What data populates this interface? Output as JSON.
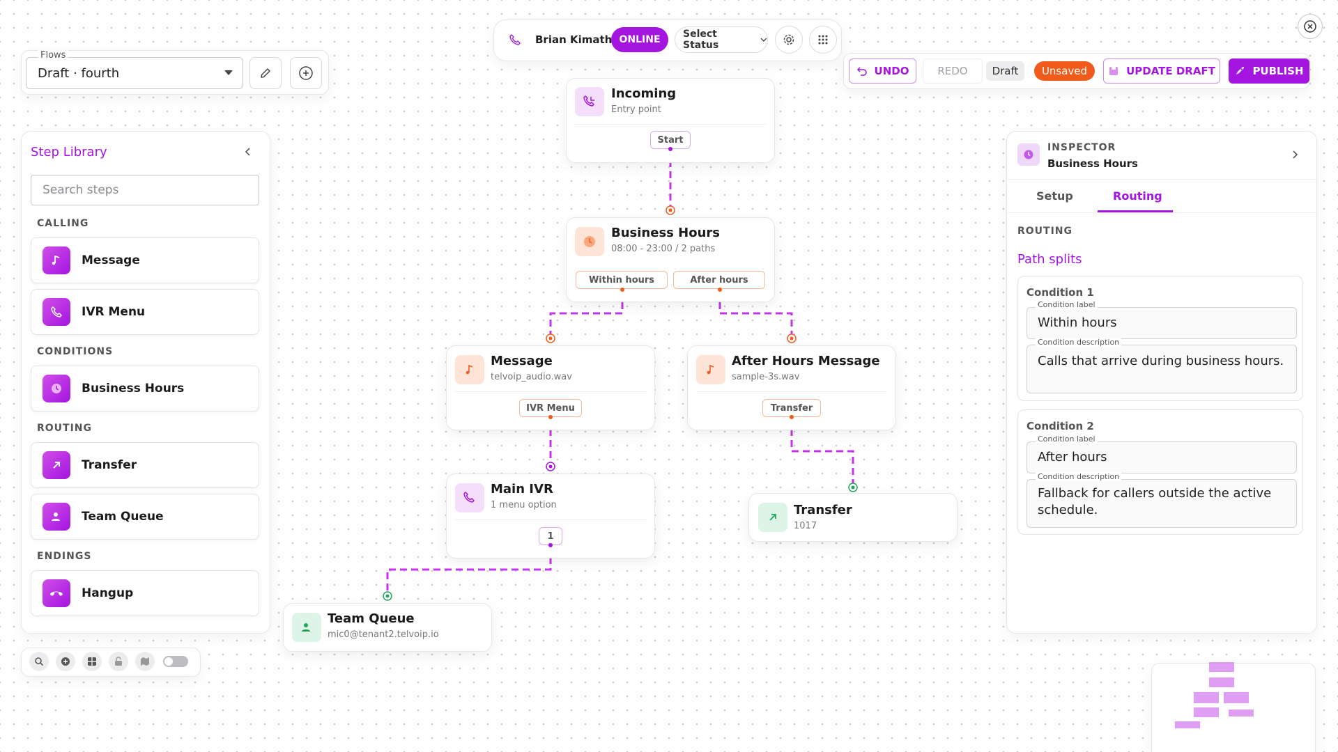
{
  "flows": {
    "label": "Flows",
    "selected": "Draft · fourth"
  },
  "agent": {
    "name": "Brian Kimathi",
    "presence": "ONLINE",
    "status_select": "Select Status"
  },
  "toolbar": {
    "undo": "UNDO",
    "redo": "REDO",
    "draft_badge": "Draft",
    "unsaved_badge": "Unsaved",
    "update_draft": "UPDATE DRAFT",
    "publish": "PUBLISH"
  },
  "library": {
    "title": "Step Library",
    "search_placeholder": "Search steps",
    "sections": [
      {
        "label": "CALLING",
        "items": [
          {
            "label": "Message",
            "icon": "music-note-icon"
          },
          {
            "label": "IVR Menu",
            "icon": "phone-menu-icon"
          }
        ]
      },
      {
        "label": "CONDITIONS",
        "items": [
          {
            "label": "Business Hours",
            "icon": "clock-icon"
          }
        ]
      },
      {
        "label": "ROUTING",
        "items": [
          {
            "label": "Transfer",
            "icon": "arrow-up-right-icon"
          },
          {
            "label": "Team Queue",
            "icon": "users-icon"
          }
        ]
      },
      {
        "label": "ENDINGS",
        "items": [
          {
            "label": "Hangup",
            "icon": "hangup-icon"
          }
        ]
      }
    ]
  },
  "nodes": {
    "incoming": {
      "title": "Incoming",
      "sub": "Entry point",
      "port": "Start"
    },
    "business_hours": {
      "title": "Business Hours",
      "sub": "08:00 - 23:00 / 2 paths",
      "port_a": "Within hours",
      "port_b": "After hours"
    },
    "message": {
      "title": "Message",
      "sub": "telvoip_audio.wav",
      "port": "IVR Menu"
    },
    "after_hours": {
      "title": "After Hours Message",
      "sub": "sample-3s.wav",
      "port": "Transfer"
    },
    "main_ivr": {
      "title": "Main IVR",
      "sub": "1 menu option",
      "port": "1"
    },
    "transfer": {
      "title": "Transfer",
      "sub": "1017"
    },
    "team_queue": {
      "title": "Team Queue",
      "sub": "mic0@tenant2.telvoip.io"
    }
  },
  "inspector": {
    "label": "INSPECTOR",
    "subject": "Business Hours",
    "tabs": [
      "Setup",
      "Routing"
    ],
    "active_tab": "Routing",
    "section": "ROUTING",
    "subheading": "Path splits",
    "conditions": [
      {
        "title": "Condition 1",
        "label_caption": "Condition label",
        "label": "Within hours",
        "desc_caption": "Condition description",
        "desc": "Calls that arrive during business hours."
      },
      {
        "title": "Condition 2",
        "label_caption": "Condition label",
        "label": "After hours",
        "desc_caption": "Condition description",
        "desc": "Fallback for callers outside the active schedule."
      }
    ]
  },
  "colors": {
    "accent": "#a415e0",
    "orange": "#f05a1a",
    "green": "#22a35a",
    "connector": "#c236e8"
  }
}
